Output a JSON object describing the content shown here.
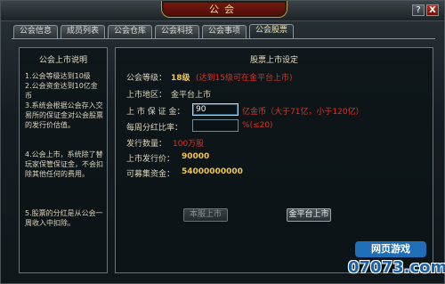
{
  "window": {
    "title": "公会",
    "help_label": "?",
    "close_label": "X"
  },
  "tabs": [
    {
      "label": "公会信息"
    },
    {
      "label": "成员列表"
    },
    {
      "label": "公会仓库"
    },
    {
      "label": "公会科技"
    },
    {
      "label": "公会事项"
    },
    {
      "label": "公会股票"
    }
  ],
  "left_panel": {
    "title": "公会上市说明",
    "items": [
      "1.公会等级达到10级",
      "2.公会资金达到10亿金币",
      "3.系统会根据公会存入交易所的保证金对公会股票的发行价估值。",
      "4.公会上市，系统除了替玩家保管保证金，不会扣除其他任何的费用。",
      "5.股票的分红是从公会一周收入中扣除。"
    ]
  },
  "right_panel": {
    "title": "股票上市设定",
    "level_label": "公会等级：",
    "level_value": "18级",
    "level_note": "(达到15级可在金平台上市)",
    "area_label": "上市地区：",
    "area_value": "金平台上市",
    "deposit_label": "上 市 保 证 金：",
    "deposit_value": "90",
    "deposit_note": "亿金币（大于71亿，小于120亿）",
    "dividend_label": "每周分红比率：",
    "dividend_value": "",
    "dividend_note": "%(≤20)",
    "shares_label": "发行数量：",
    "shares_value": "100万股",
    "price_label": "上市发行价：",
    "price_value": "90000",
    "raise_label": "可募集资金：",
    "raise_value": "54000000000",
    "local_button": "本服上市",
    "platform_button": "金平台上市"
  },
  "watermark": {
    "top": "网页游戏",
    "bottom": "07073.com"
  }
}
